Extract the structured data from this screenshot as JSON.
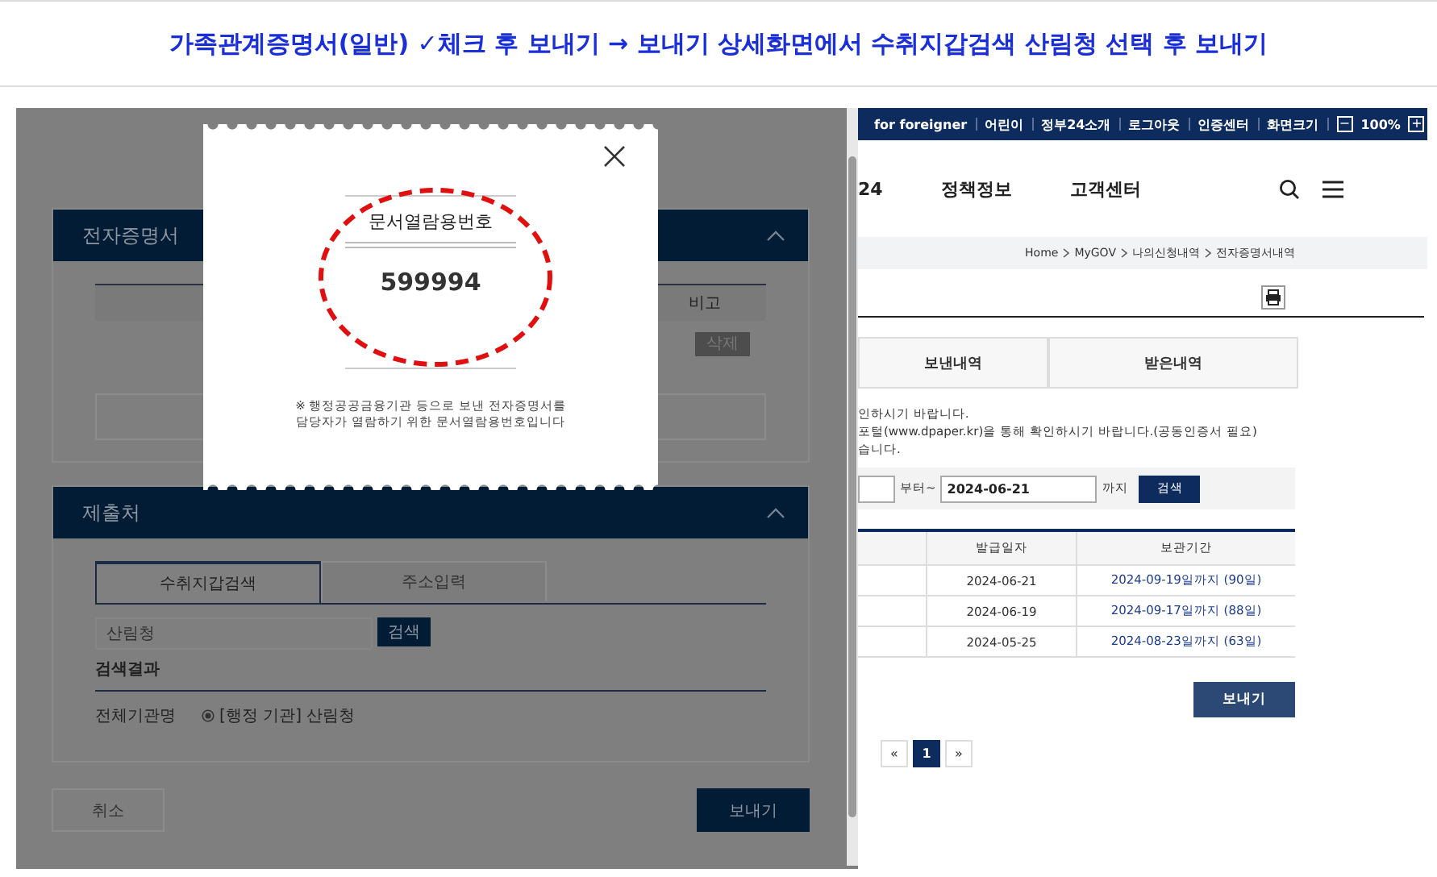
{
  "title": "가족관계증명서(일반) ✓체크 후 보내기 → 보내기 상세화면에서 수취지갑검색 산림청 선택 후 보내기",
  "left": {
    "section1": {
      "title": "전자증명서",
      "col_header": "비고",
      "delete_button": "삭제"
    },
    "section2": {
      "title": "제출처",
      "tabs": [
        {
          "label": "수취지갑검색",
          "selected": true
        },
        {
          "label": "주소입력",
          "selected": false
        }
      ],
      "search": {
        "value": "산림청",
        "button": "검색"
      },
      "results_label": "검색결과",
      "result": {
        "label": "전체기관명",
        "option": "[행정 기관] 산림청",
        "selected": true
      }
    },
    "buttons": [
      {
        "label": "취소",
        "kind": "secondary"
      },
      {
        "label": "보내기",
        "kind": "primary"
      }
    ]
  },
  "modal": {
    "heading": "문서열람용번호",
    "number": "599994",
    "note_lines": [
      "※ 행정공공금융기관 등으로 보낸 전자증명서를",
      "담당자가 열람하기 위한 문서열람용번호입니다"
    ]
  },
  "right": {
    "utility_links": [
      "for foreigner",
      "어린이",
      "정부24소개",
      "로그아웃",
      "인증센터",
      "화면크기"
    ],
    "zoom": {
      "minus": "−",
      "value": "100%",
      "plus": "+"
    },
    "nav": [
      "24",
      "정책정보",
      "고객센터"
    ],
    "breadcrumb": [
      "Home",
      "MyGOV",
      "나의신청내역",
      "전자증명서내역"
    ],
    "tabs": [
      {
        "label": "보낸내역",
        "selected": false
      },
      {
        "label": "받은내역",
        "selected": false
      }
    ],
    "notices": [
      "인하시기 바랍니다.",
      "포털(www.dpaper.kr)을 통해 확인하시기 바랍니다.(공동인증서 필요)",
      "습니다."
    ],
    "date_search": {
      "from_suffix": "부터~",
      "to_value": "2024-06-21",
      "to_suffix": "까지",
      "button": "검색"
    },
    "table": {
      "columns": [
        "발급일자",
        "보관기간"
      ],
      "rows": [
        [
          "2024-06-21",
          "2024-09-19일까지 (90일)"
        ],
        [
          "2024-06-19",
          "2024-09-17일까지 (88일)"
        ],
        [
          "2024-05-25",
          "2024-08-23일까지 (63일)"
        ]
      ]
    },
    "send_button": "보내기",
    "pagination": {
      "prev": "«",
      "pages": [
        {
          "label": "1",
          "selected": true
        }
      ],
      "next": "»"
    }
  }
}
